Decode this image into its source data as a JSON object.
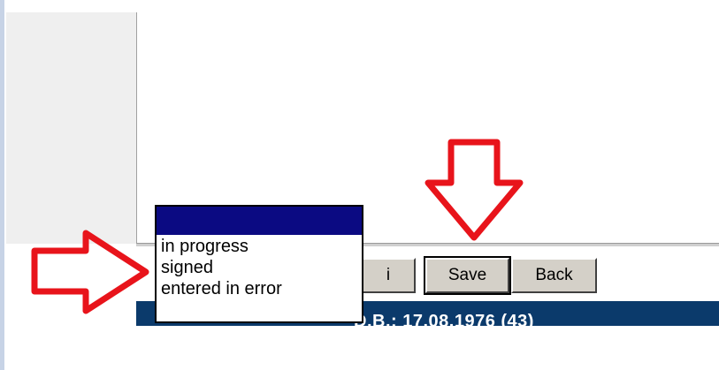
{
  "toolbar": {
    "info_label": "i",
    "save_label": "Save",
    "back_label": "Back"
  },
  "patient_bar": {
    "text": "D.B.: 17.08.1976 (43)"
  },
  "status_dropdown": {
    "selected_value": "",
    "options": [
      "in progress",
      "signed",
      "entered in error"
    ]
  },
  "annotations": {
    "arrow_color": "#e8141b"
  },
  "colors": {
    "patient_bar": "#0b3a6b",
    "dropdown_highlight": "#0b0a82",
    "button_face": "#d4d0c8"
  }
}
